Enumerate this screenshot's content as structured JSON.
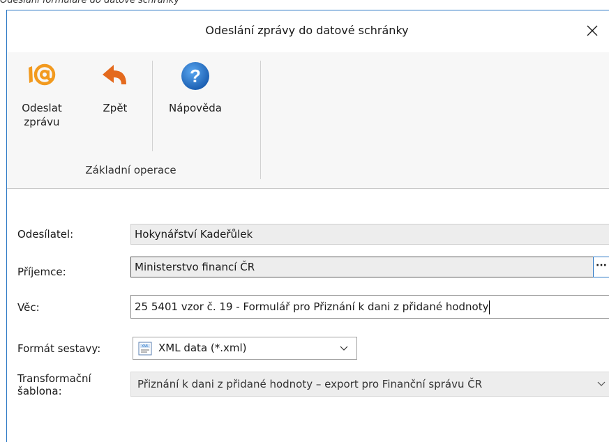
{
  "caption": "Odeslání formuláře do datové schránky",
  "window": {
    "title": "Odeslání zprávy do datové schránky",
    "close_glyph": "✕"
  },
  "ribbon": {
    "send": {
      "label_line1": "Odeslat",
      "label_line2": "zprávu",
      "icon": "at-sign-icon"
    },
    "back": {
      "label": "Zpět",
      "icon": "back-arrow-icon"
    },
    "help": {
      "label": "Nápověda",
      "icon": "help-icon"
    },
    "group_label": "Základní operace"
  },
  "form": {
    "sender_label": "Odesílatel:",
    "sender_value": "Hokynářství Kadeřůlek",
    "recipient_label": "Příjemce:",
    "recipient_value": "Ministerstvo financí ČR",
    "browse_glyph": "···",
    "subject_label": "Věc:",
    "subject_value": "25 5401 vzor č. 19 - Formulář pro Přiznání k dani z přidané hodnoty",
    "format_label": "Formát sestavy:",
    "format_value": "XML data (*.xml)",
    "template_label_line1": "Transformační",
    "template_label_line2": "šablona:",
    "template_value": "Přiznání k dani z přidané hodnoty – export pro Finanční správu ČR"
  },
  "colors": {
    "accent_border": "#2b78c5",
    "send_icon_orange": "#f29a1f",
    "back_icon_orange": "#e46a1e",
    "help_icon_blue": "#1f6fc4"
  }
}
